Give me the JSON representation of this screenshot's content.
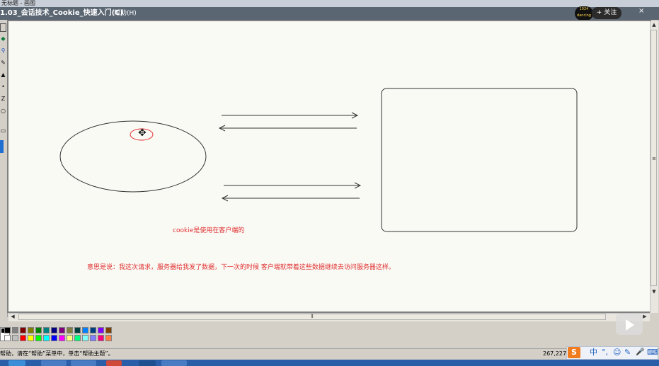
{
  "window": {
    "title": "无标题 - 画图"
  },
  "video": {
    "title": "1.03_会话技术_Cookie_快速入门(C)"
  },
  "menu": {
    "help": "帮助(H)"
  },
  "overlay": {
    "avatar_text": "1024 dancing",
    "follow_label": "+ 关注",
    "close": "×"
  },
  "toolbox": {
    "tools": [
      "select-icon",
      "eraser-icon",
      "magnifier-icon",
      "pencil-icon",
      "brush-icon",
      "airbrush-icon",
      "text-icon",
      "shape-icon",
      "rectangle-icon",
      "ellipse-icon"
    ]
  },
  "canvas": {
    "cursor": "✥",
    "cookie_note": "cookie是使用在客户端的",
    "meaning_note": "意思是说：我这次请求，服务器给我发了数据，下一次的时候 客户端就带着这些数据继续去访问服务器这样。",
    "text_color": "#e03030"
  },
  "palette": {
    "row1": [
      "#000000",
      "#808080",
      "#800000",
      "#808000",
      "#008000",
      "#008080",
      "#000080",
      "#800080",
      "#808040",
      "#004040",
      "#0080ff",
      "#004080",
      "#8000ff",
      "#804000"
    ],
    "row2": [
      "#ffffff",
      "#c0c0c0",
      "#ff0000",
      "#ffff00",
      "#00ff00",
      "#00ffff",
      "#0000ff",
      "#ff00ff",
      "#ffff80",
      "#00ff80",
      "#80ffff",
      "#8080ff",
      "#ff0080",
      "#ff8040"
    ]
  },
  "status": {
    "help_text": "帮助，请在“帮助”菜单中，单击“帮助主题”。",
    "coords": "267,227"
  },
  "ime": {
    "logo": "S",
    "mode": "中",
    "punct": "°,",
    "emoji": "☺",
    "pen": "✎",
    "mic": "🎤",
    "keyboard": "⌨"
  }
}
